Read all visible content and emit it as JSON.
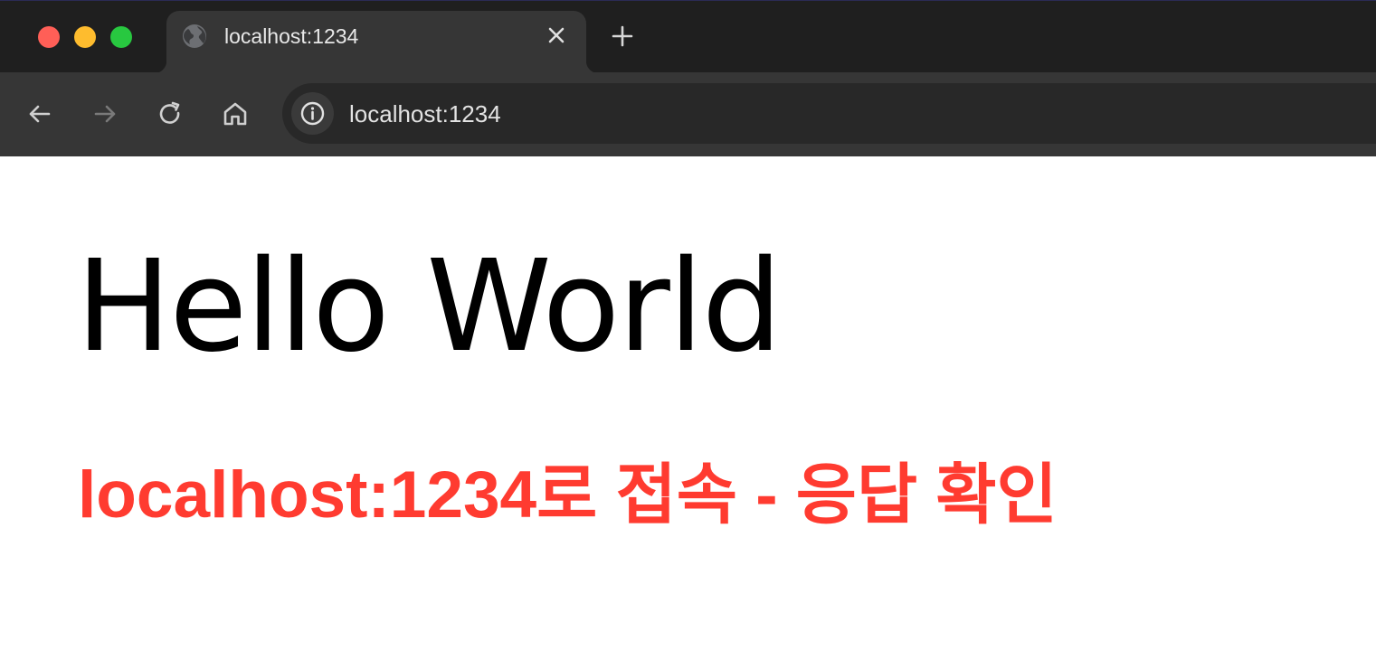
{
  "window": {
    "traffic_lights": {
      "close_color": "#ff5f57",
      "minimize_color": "#febc2e",
      "maximize_color": "#28c840"
    }
  },
  "tabs": [
    {
      "title": "localhost:1234",
      "favicon": "globe-icon",
      "active": true
    }
  ],
  "new_tab_icon": "plus-icon",
  "toolbar": {
    "back_icon": "arrow-left-icon",
    "forward_icon": "arrow-right-icon",
    "forward_enabled": false,
    "reload_icon": "reload-icon",
    "home_icon": "home-icon"
  },
  "omnibox": {
    "site_info_icon": "info-icon",
    "url": "localhost:1234"
  },
  "page": {
    "heading": "Hello World",
    "subheading": "localhost:1234로 접속 - 응답 확인",
    "subheading_color": "#ff3b30"
  }
}
